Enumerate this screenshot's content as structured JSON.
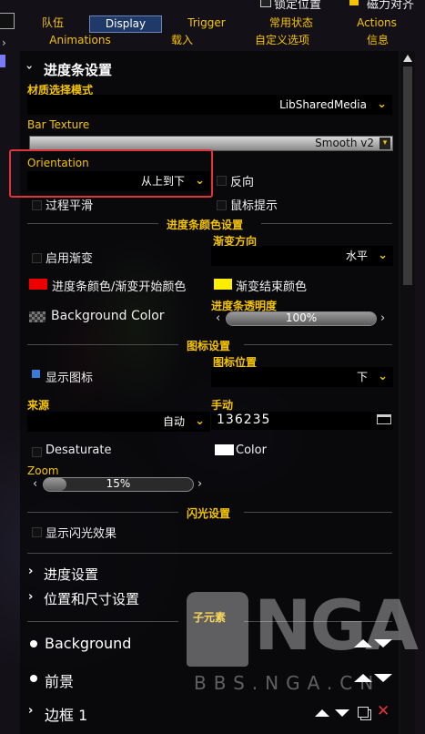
{
  "topbar": {
    "lock_position": "锁定位置",
    "magnet_align": "磁力对齐"
  },
  "tabs_row1": [
    "队伍",
    "Display",
    "Trigger",
    "常用状态",
    "Actions"
  ],
  "tabs_row2": [
    "Animations",
    "载入",
    "自定义选项",
    "信息"
  ],
  "progress_section": {
    "title": "进度条设置",
    "texture_mode_label": "材质选择模式",
    "texture_mode_value": "LibSharedMedia",
    "bar_texture_label": "Bar Texture",
    "bar_texture_value": "Smooth v2",
    "orientation_label": "Orientation",
    "orientation_value": "从上到下",
    "reverse_label": "反向",
    "smooth_label": "过程平滑",
    "tooltip_label": "鼠标提示"
  },
  "color_section": {
    "title": "进度条颜色设置",
    "gradient_direction_label": "渐变方向",
    "enable_gradient_label": "启用渐变",
    "gradient_direction_value": "水平",
    "bar_color_label": "进度条颜色/渐变开始颜色",
    "bar_color": "#ee0000",
    "gradient_end_label": "渐变结束颜色",
    "gradient_end_color": "#ffee00",
    "background_color_label": "Background Color",
    "opacity_label": "进度条透明度",
    "opacity_value": "100%",
    "opacity_fraction": 1.0
  },
  "icon_section": {
    "title": "图标设置",
    "show_icon_label": "显示图标",
    "icon_position_label": "图标位置",
    "icon_position_value": "下",
    "source_label": "来源",
    "source_value": "自动",
    "manual_label": "手动",
    "manual_value": "136235",
    "desaturate_label": "Desaturate",
    "color_label": "Color",
    "zoom_label": "Zoom",
    "zoom_value": "15%",
    "zoom_fraction": 0.15
  },
  "glow_section": {
    "title": "闪光设置",
    "show_glow_label": "显示闪光效果"
  },
  "collapsed": {
    "progress_settings": "进度设置",
    "position_size": "位置和尺寸设置"
  },
  "sub_elements": {
    "title": "子元素",
    "items": [
      "Background",
      "前景",
      "边框 1"
    ]
  },
  "watermark": {
    "text": "BBS.NGA.CN"
  },
  "colors": {
    "accent": "#f5c400",
    "tab_selected": "#1f3a68",
    "highlight_box": "#e0343a"
  }
}
